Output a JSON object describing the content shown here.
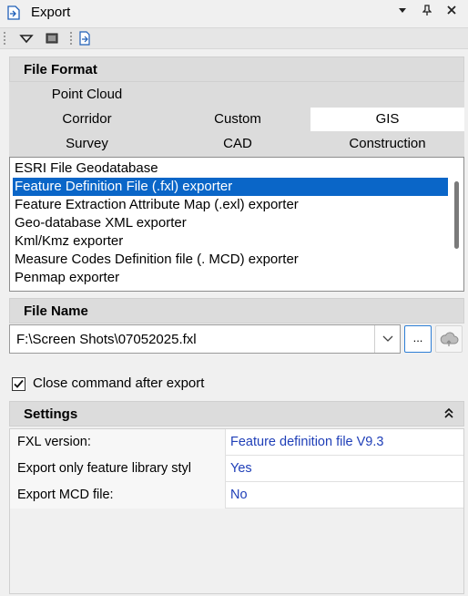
{
  "window": {
    "title": "Export",
    "controls": {
      "dropdown": "▾",
      "pin": "📌",
      "close": "✕"
    }
  },
  "toolbar": {
    "icons": [
      "menu-dropdown-icon",
      "monitor-icon",
      "export-icon"
    ]
  },
  "file_format": {
    "header": "File Format",
    "tabs": [
      {
        "label": "Point Cloud",
        "selected": false
      },
      {
        "label": "Corridor",
        "selected": false
      },
      {
        "label": "Custom",
        "selected": false
      },
      {
        "label": "GIS",
        "selected": true
      },
      {
        "label": "Survey",
        "selected": false
      },
      {
        "label": "CAD",
        "selected": false
      },
      {
        "label": "Construction",
        "selected": false
      }
    ],
    "exporters": [
      {
        "label": "ESRI File Geodatabase",
        "selected": false
      },
      {
        "label": "Feature Definition File (.fxl) exporter",
        "selected": true
      },
      {
        "label": "Feature Extraction Attribute Map (.exl) exporter",
        "selected": false
      },
      {
        "label": "Geo-database XML exporter",
        "selected": false
      },
      {
        "label": "Kml/Kmz exporter",
        "selected": false
      },
      {
        "label": "Measure Codes Definition file (. MCD) exporter",
        "selected": false
      },
      {
        "label": "Penmap exporter",
        "selected": false
      }
    ]
  },
  "file_name": {
    "header": "File Name",
    "value": "F:\\Screen Shots\\07052025.fxl",
    "browse_label": "..."
  },
  "close_after_export": {
    "label": "Close command after export",
    "checked": true
  },
  "settings": {
    "header": "Settings",
    "collapse_glyph": "»",
    "rows": [
      {
        "key": "FXL version:",
        "value": "Feature definition file V9.3"
      },
      {
        "key": "Export only feature library styl",
        "value": "Yes"
      },
      {
        "key": "Export MCD file:",
        "value": "No"
      }
    ]
  },
  "colors": {
    "selection": "#0a66c8",
    "value_text": "#1f3fb8",
    "browse_border": "#2e7fd6"
  }
}
